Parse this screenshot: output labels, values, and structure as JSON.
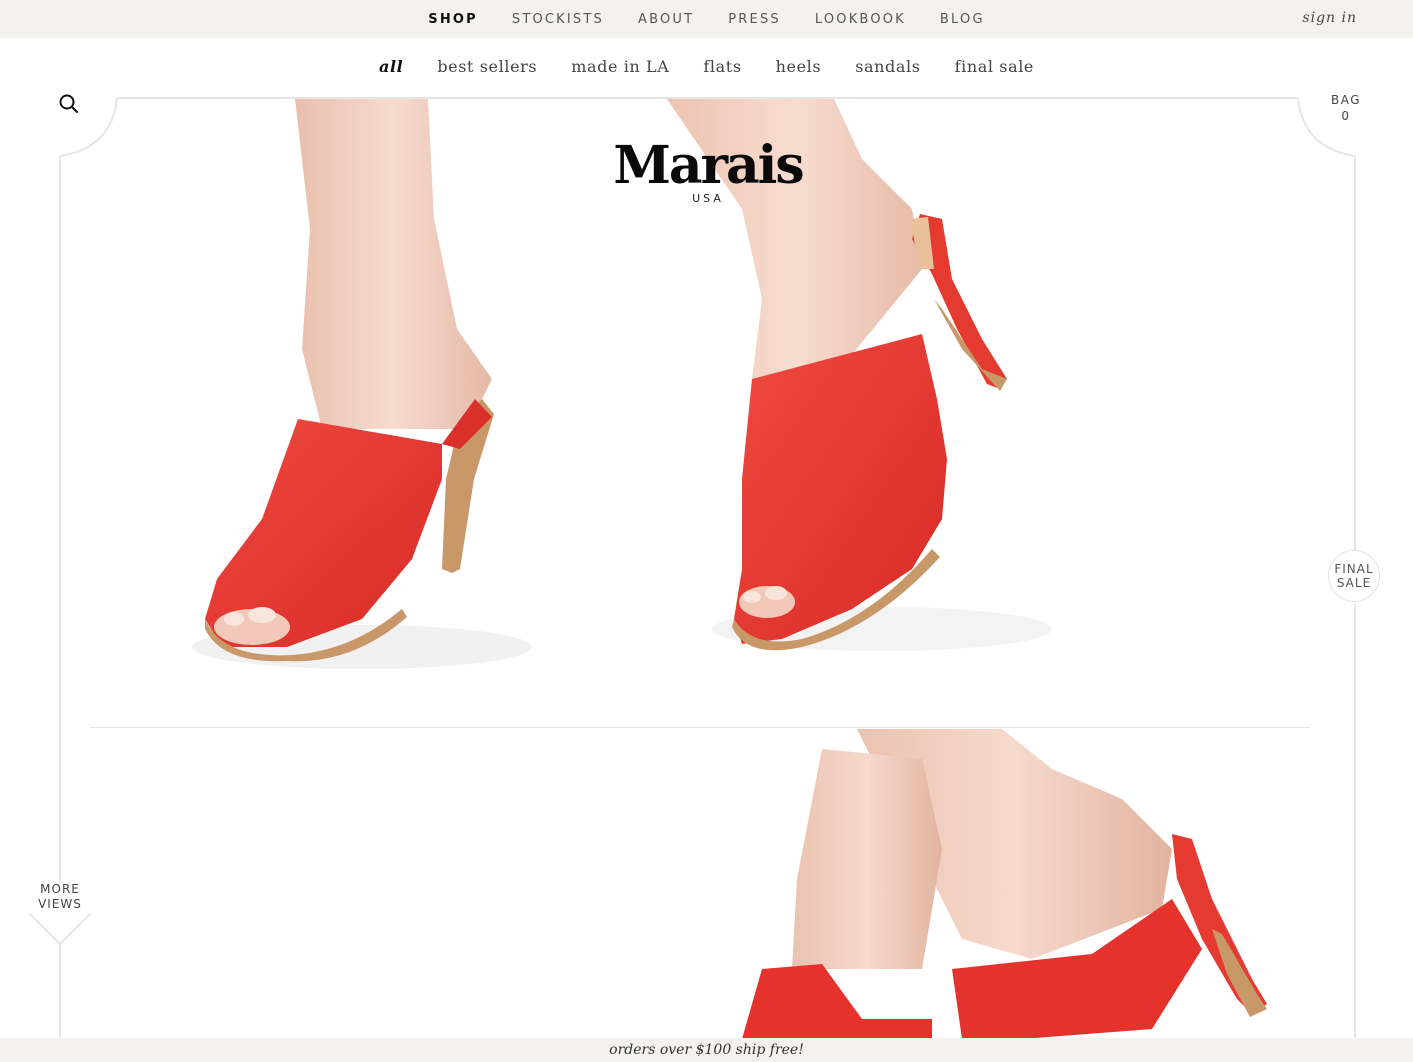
{
  "top_nav": {
    "items": [
      {
        "label": "SHOP",
        "active": true
      },
      {
        "label": "STOCKISTS",
        "active": false
      },
      {
        "label": "ABOUT",
        "active": false
      },
      {
        "label": "PRESS",
        "active": false
      },
      {
        "label": "LOOKBOOK",
        "active": false
      },
      {
        "label": "BLOG",
        "active": false
      }
    ],
    "sign_in": "sign in"
  },
  "sub_nav": {
    "items": [
      {
        "label": "all",
        "active": true
      },
      {
        "label": "best sellers",
        "active": false
      },
      {
        "label": "made in LA",
        "active": false
      },
      {
        "label": "flats",
        "active": false
      },
      {
        "label": "heels",
        "active": false
      },
      {
        "label": "sandals",
        "active": false
      },
      {
        "label": "final sale",
        "active": false
      }
    ]
  },
  "header": {
    "search_icon": "search-icon",
    "bag_label": "BAG",
    "bag_count": "0"
  },
  "brand": {
    "name": "Marais",
    "sub": "USA"
  },
  "badges": {
    "final_sale_line1": "FINAL",
    "final_sale_line2": "SALE"
  },
  "gallery": {
    "more_views_line1": "MORE",
    "more_views_line2": "VIEWS"
  },
  "promo": {
    "text": "orders over $100 ship free!"
  },
  "colors": {
    "topbar_bg": "#f4f2ee",
    "shoe_red": "#e5322c",
    "heel_tan": "#c89868",
    "skin": "#f1cfc0"
  }
}
